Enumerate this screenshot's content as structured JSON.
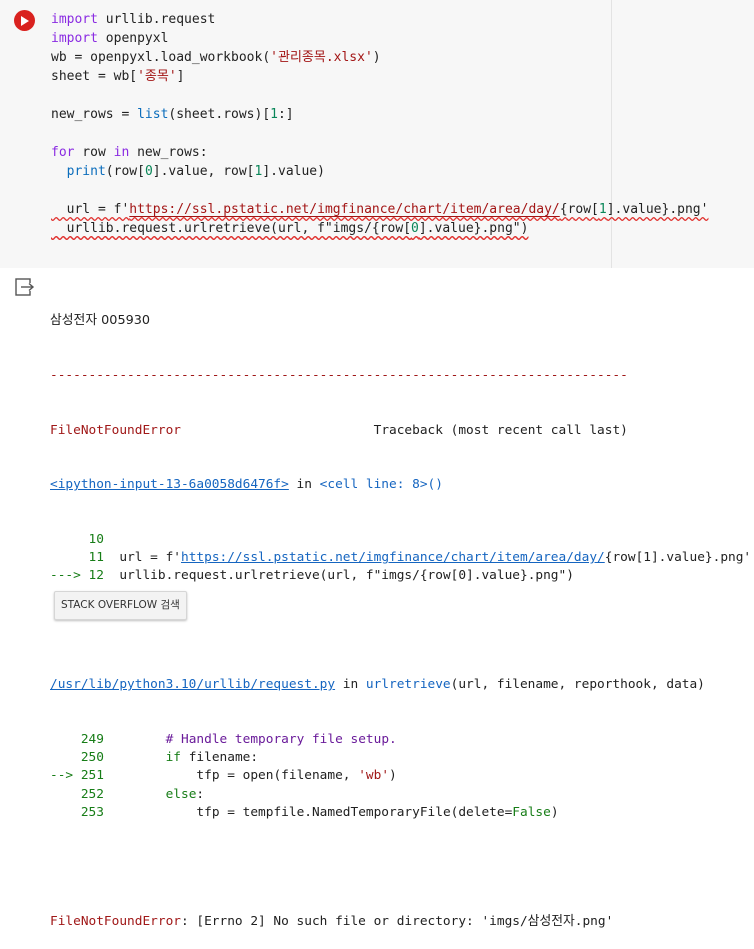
{
  "cell": {
    "code_lines": [
      "import urllib.request",
      "import openpyxl",
      "wb = openpyxl.load_workbook('관리종목.xlsx')",
      "sheet = wb['종목']",
      "",
      "new_rows = list(sheet.rows)[1:]",
      "",
      "for row in new_rows:",
      "  print(row[0].value, row[1].value)",
      "",
      "  url = f'https://ssl.pstatic.net/imgfinance/chart/item/area/day/{row[1].value}.png'",
      "  urllib.request.urlretrieve(url, f\"imgs/{row[0].value}.png\")"
    ]
  },
  "output": {
    "print_line": "삼성전자 005930",
    "rule": "---------------------------------------------------------------------------",
    "error_name": "FileNotFoundError",
    "traceback_header": "Traceback (most recent call last)",
    "input_link": "<ipython-input-13-6a0058d6476f>",
    "in_word": " in ",
    "cell_ref": "<cell line: 8>()",
    "frame1": [
      {
        "marker": "     ",
        "num": "10",
        "code": ""
      },
      {
        "marker": "     ",
        "num": "11",
        "code": "  url = f'https://ssl.pstatic.net/imgfinance/chart/item/area/day/{row[1].value}.png'"
      },
      {
        "marker": "---> ",
        "num": "12",
        "code": "  urllib.request.urlretrieve(url, f\"imgs/{row[0].value}.png\")"
      }
    ],
    "file_link": "/usr/lib/python3.10/urllib/request.py",
    "func_ref": "urlretrieve",
    "func_args": "(url, filename, reporthook, data)",
    "frame2": [
      {
        "marker": "    ",
        "num": "249",
        "code": "        # Handle temporary file setup."
      },
      {
        "marker": "    ",
        "num": "250",
        "code": "        if filename:"
      },
      {
        "marker": "--> ",
        "num": "251",
        "code": "            tfp = open(filename, 'wb')"
      },
      {
        "marker": "    ",
        "num": "252",
        "code": "        else:"
      },
      {
        "marker": "    ",
        "num": "253",
        "code": "            tfp = tempfile.NamedTemporaryFile(delete=False)"
      }
    ],
    "error_message": ": [Errno 2] No such file or directory: 'imgs/삼성전자.png'",
    "so_button": "STACK OVERFLOW 검색"
  }
}
